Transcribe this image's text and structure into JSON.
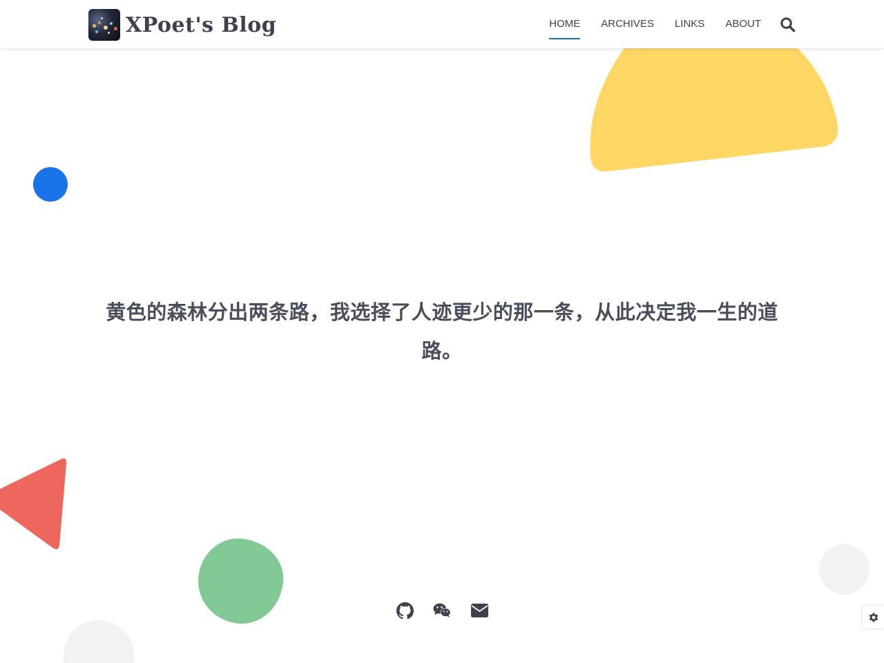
{
  "header": {
    "site_title": "XPoet's Blog",
    "logo": "blog-logo-night-lights",
    "nav": [
      {
        "label": "HOME",
        "active": true
      },
      {
        "label": "ARCHIVES",
        "active": false
      },
      {
        "label": "LINKS",
        "active": false
      },
      {
        "label": "ABOUT",
        "active": false
      }
    ],
    "search_icon": "search-icon",
    "active_underline_color": "#1f6fb5"
  },
  "hero": {
    "motto": "黄色的森林分出两条路，我选择了人迹更少的那一条，从此决定我一生的道路。"
  },
  "socials": [
    {
      "icon": "github-icon"
    },
    {
      "icon": "wechat-icon"
    },
    {
      "icon": "envelope-icon"
    }
  ],
  "settings": {
    "icon": "gear-icon"
  },
  "colors": {
    "text": "#40414f",
    "yellow": "#fdd663",
    "blue": "#1a73e8",
    "red": "#ee675c",
    "green": "#82c995",
    "grey": "#f1f2f4"
  }
}
